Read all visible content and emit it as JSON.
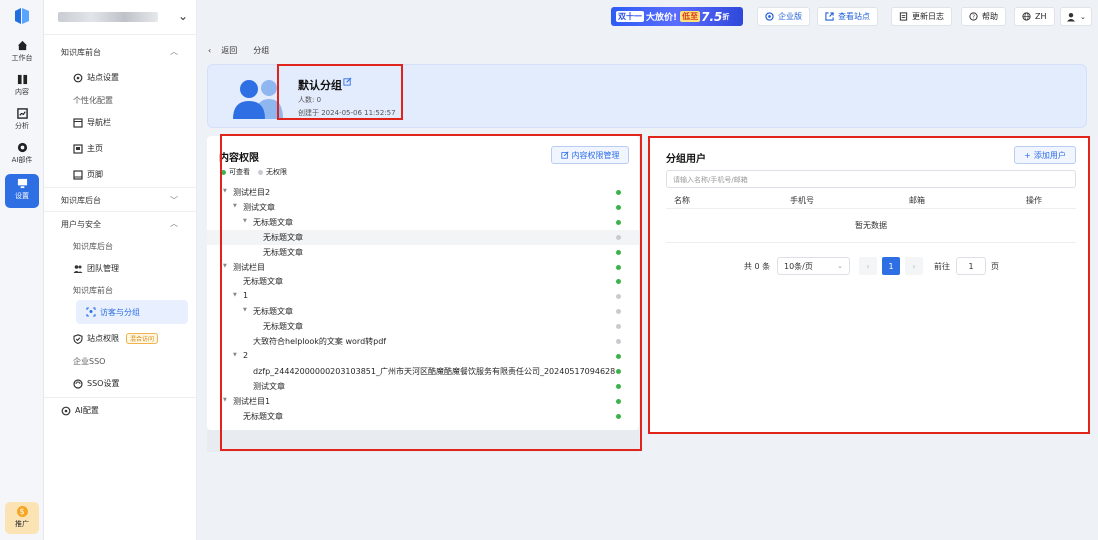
{
  "rail": {
    "items": [
      {
        "label": "工作台",
        "icon": "home-icon"
      },
      {
        "label": "内容",
        "icon": "content-icon"
      },
      {
        "label": "分析",
        "icon": "chart-icon"
      },
      {
        "label": "AI部件",
        "icon": "ai-widget-icon"
      },
      {
        "label": "设置",
        "icon": "settings-icon"
      }
    ],
    "promo_label": "推广"
  },
  "sidebar": {
    "sections": [
      {
        "label": "知识库前台"
      },
      {
        "label": "知识库后台"
      },
      {
        "label": "用户与安全"
      }
    ],
    "items": {
      "site_settings": "站点设置",
      "personalize": "个性化配置",
      "navbar": "导航栏",
      "homepage": "主页",
      "footer": "页脚",
      "kb_backend": "知识库后台",
      "team_mgmt": "团队管理",
      "kb_frontend": "知识库前台",
      "visitor_groups": "访客与分组",
      "site_perm": "站点权限",
      "site_perm_tag": "混合访问",
      "enterprise_sso": "企业SSO",
      "sso_settings": "SSO设置",
      "ai_config": "AI配置"
    }
  },
  "topbar": {
    "banner": {
      "part1": "双十一",
      "part2": "大放价!",
      "part3": "低至",
      "part4": "7.5",
      "part5": "折"
    },
    "edition": "企业版",
    "view_site": "查看站点",
    "changelog": "更新日志",
    "help": "帮助",
    "lang": "ZH"
  },
  "breadcrumb": {
    "back": "返回",
    "current": "分组"
  },
  "group": {
    "name": "默认分组",
    "count": "人数: 0",
    "created": "创建于 2024-05-06 11:52:57"
  },
  "permissions": {
    "title": "内容权限",
    "manage_button": "内容权限管理",
    "legend_view": "可查看",
    "legend_none": "无权限",
    "colors": {
      "view": "#3cb34a",
      "none": "#c8cbd0"
    },
    "tree": [
      {
        "label": "测试栏目2",
        "level": 0,
        "arrow": true,
        "status": "view"
      },
      {
        "label": "测试文章",
        "level": 1,
        "arrow": true,
        "status": "view"
      },
      {
        "label": "无标题文章",
        "level": 2,
        "arrow": true,
        "status": "view"
      },
      {
        "label": "无标题文章",
        "level": 3,
        "arrow": false,
        "status": "none",
        "highlight": true
      },
      {
        "label": "无标题文章",
        "level": 3,
        "arrow": false,
        "status": "view"
      },
      {
        "label": "测试栏目",
        "level": 0,
        "arrow": true,
        "status": "view"
      },
      {
        "label": "无标题文章",
        "level": 1,
        "arrow": false,
        "status": "view"
      },
      {
        "label": "1",
        "level": 1,
        "arrow": true,
        "status": "none"
      },
      {
        "label": "无标题文章",
        "level": 2,
        "arrow": true,
        "status": "none"
      },
      {
        "label": "无标题文章",
        "level": 3,
        "arrow": false,
        "status": "none"
      },
      {
        "label": "大致符合helplook的文案 word转pdf",
        "level": 2,
        "arrow": false,
        "status": "none"
      },
      {
        "label": "2",
        "level": 1,
        "arrow": true,
        "status": "view"
      },
      {
        "label": "dzfp_24442000000203103851_广州市天河区酷魔酷魔餐饮服务有限责任公司_20240517094628",
        "level": 2,
        "arrow": false,
        "status": "view"
      },
      {
        "label": "测试文章",
        "level": 2,
        "arrow": false,
        "status": "view"
      },
      {
        "label": "测试栏目1",
        "level": 0,
        "arrow": true,
        "status": "view"
      },
      {
        "label": "无标题文章",
        "level": 1,
        "arrow": false,
        "status": "view"
      }
    ]
  },
  "users": {
    "title": "分组用户",
    "add_button": "添加用户",
    "search_placeholder": "请输入名称/手机号/邮箱",
    "columns": [
      "名称",
      "手机号",
      "邮箱",
      "操作"
    ],
    "empty": "暂无数据",
    "pager": {
      "total": "共 0 条",
      "page_size": "10条/页",
      "page": "1",
      "goto_label": "前往",
      "goto_value": "1",
      "page_unit": "页"
    }
  }
}
